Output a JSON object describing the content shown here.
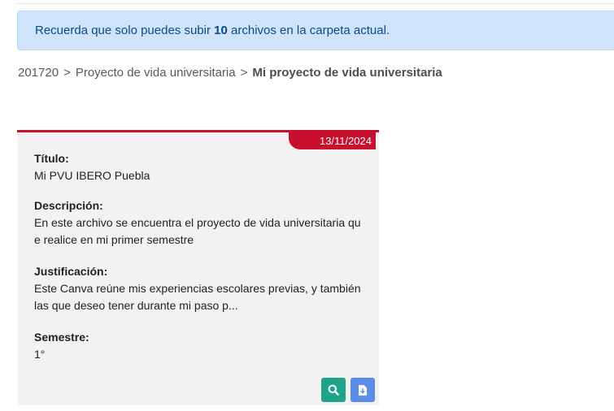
{
  "notice": {
    "prefix": "Recuerda que solo puedes subir ",
    "count": "10",
    "suffix": " archivos en la carpeta actual."
  },
  "breadcrumb": {
    "items": [
      "201720",
      "Proyecto de vida universitaria"
    ],
    "separator": ">",
    "current": "Mi proyecto de vida universitaria"
  },
  "card": {
    "date": "13/11/2024",
    "title_label": "Título:",
    "title_value": "Mi PVU IBERO Puebla",
    "description_label": "Descripción:",
    "description_line1": "En este archivo se encuentra el proyecto de vida universitaria qu",
    "description_line2": "e realice en mi primer semestre",
    "justification_label": "Justificación:",
    "justification_line1": "Este Canva reúne mis experiencias escolares previas, y también",
    "justification_line2": "las que deseo tener durante mi paso p...",
    "semester_label": "Semestre:",
    "semester_value": "1°",
    "actions": [
      {
        "icon": "search-icon",
        "color": "#1ea48b"
      },
      {
        "icon": "download-file-icon",
        "color": "#5b8de8"
      }
    ]
  },
  "colors": {
    "accent": "#c8102e",
    "alert_bg": "#cfe4fb",
    "alert_text": "#0b4a84"
  }
}
